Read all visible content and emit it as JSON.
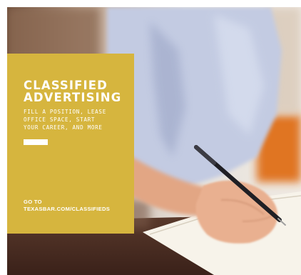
{
  "ad": {
    "headline_line1": "CLASSIFIED",
    "headline_line2": "ADVERTISING",
    "subtext_line1": "FILL A POSITION, LEASE",
    "subtext_line2": "OFFICE SPACE, START",
    "subtext_line3": "YOUR CAREER, AND MORE",
    "goto_line1": "GO TO",
    "goto_line2": "TEXASBAR.COM/CLASSIFIEDS"
  },
  "colors": {
    "panel": "#d6b53e",
    "text": "#ffffff",
    "shirt": "#c3cbe2",
    "skin": "#e2a684",
    "background_orange": "#e07422",
    "notepad": "#f7f3ea"
  }
}
